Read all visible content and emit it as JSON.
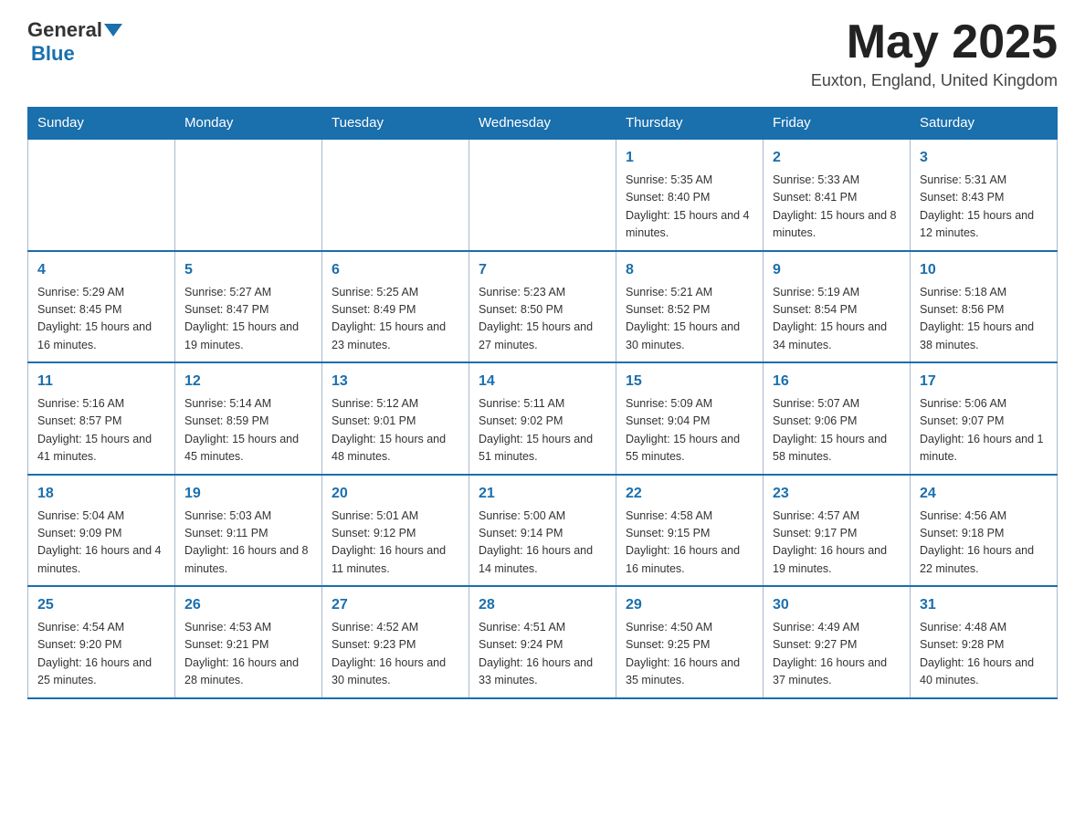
{
  "header": {
    "logo": {
      "general": "General",
      "triangle_label": "triangle-icon",
      "blue": "Blue"
    },
    "title": "May 2025",
    "location": "Euxton, England, United Kingdom"
  },
  "days_of_week": [
    "Sunday",
    "Monday",
    "Tuesday",
    "Wednesday",
    "Thursday",
    "Friday",
    "Saturday"
  ],
  "weeks": [
    [
      {
        "day": "",
        "info": ""
      },
      {
        "day": "",
        "info": ""
      },
      {
        "day": "",
        "info": ""
      },
      {
        "day": "",
        "info": ""
      },
      {
        "day": "1",
        "info": "Sunrise: 5:35 AM\nSunset: 8:40 PM\nDaylight: 15 hours\nand 4 minutes."
      },
      {
        "day": "2",
        "info": "Sunrise: 5:33 AM\nSunset: 8:41 PM\nDaylight: 15 hours\nand 8 minutes."
      },
      {
        "day": "3",
        "info": "Sunrise: 5:31 AM\nSunset: 8:43 PM\nDaylight: 15 hours\nand 12 minutes."
      }
    ],
    [
      {
        "day": "4",
        "info": "Sunrise: 5:29 AM\nSunset: 8:45 PM\nDaylight: 15 hours\nand 16 minutes."
      },
      {
        "day": "5",
        "info": "Sunrise: 5:27 AM\nSunset: 8:47 PM\nDaylight: 15 hours\nand 19 minutes."
      },
      {
        "day": "6",
        "info": "Sunrise: 5:25 AM\nSunset: 8:49 PM\nDaylight: 15 hours\nand 23 minutes."
      },
      {
        "day": "7",
        "info": "Sunrise: 5:23 AM\nSunset: 8:50 PM\nDaylight: 15 hours\nand 27 minutes."
      },
      {
        "day": "8",
        "info": "Sunrise: 5:21 AM\nSunset: 8:52 PM\nDaylight: 15 hours\nand 30 minutes."
      },
      {
        "day": "9",
        "info": "Sunrise: 5:19 AM\nSunset: 8:54 PM\nDaylight: 15 hours\nand 34 minutes."
      },
      {
        "day": "10",
        "info": "Sunrise: 5:18 AM\nSunset: 8:56 PM\nDaylight: 15 hours\nand 38 minutes."
      }
    ],
    [
      {
        "day": "11",
        "info": "Sunrise: 5:16 AM\nSunset: 8:57 PM\nDaylight: 15 hours\nand 41 minutes."
      },
      {
        "day": "12",
        "info": "Sunrise: 5:14 AM\nSunset: 8:59 PM\nDaylight: 15 hours\nand 45 minutes."
      },
      {
        "day": "13",
        "info": "Sunrise: 5:12 AM\nSunset: 9:01 PM\nDaylight: 15 hours\nand 48 minutes."
      },
      {
        "day": "14",
        "info": "Sunrise: 5:11 AM\nSunset: 9:02 PM\nDaylight: 15 hours\nand 51 minutes."
      },
      {
        "day": "15",
        "info": "Sunrise: 5:09 AM\nSunset: 9:04 PM\nDaylight: 15 hours\nand 55 minutes."
      },
      {
        "day": "16",
        "info": "Sunrise: 5:07 AM\nSunset: 9:06 PM\nDaylight: 15 hours\nand 58 minutes."
      },
      {
        "day": "17",
        "info": "Sunrise: 5:06 AM\nSunset: 9:07 PM\nDaylight: 16 hours\nand 1 minute."
      }
    ],
    [
      {
        "day": "18",
        "info": "Sunrise: 5:04 AM\nSunset: 9:09 PM\nDaylight: 16 hours\nand 4 minutes."
      },
      {
        "day": "19",
        "info": "Sunrise: 5:03 AM\nSunset: 9:11 PM\nDaylight: 16 hours\nand 8 minutes."
      },
      {
        "day": "20",
        "info": "Sunrise: 5:01 AM\nSunset: 9:12 PM\nDaylight: 16 hours\nand 11 minutes."
      },
      {
        "day": "21",
        "info": "Sunrise: 5:00 AM\nSunset: 9:14 PM\nDaylight: 16 hours\nand 14 minutes."
      },
      {
        "day": "22",
        "info": "Sunrise: 4:58 AM\nSunset: 9:15 PM\nDaylight: 16 hours\nand 16 minutes."
      },
      {
        "day": "23",
        "info": "Sunrise: 4:57 AM\nSunset: 9:17 PM\nDaylight: 16 hours\nand 19 minutes."
      },
      {
        "day": "24",
        "info": "Sunrise: 4:56 AM\nSunset: 9:18 PM\nDaylight: 16 hours\nand 22 minutes."
      }
    ],
    [
      {
        "day": "25",
        "info": "Sunrise: 4:54 AM\nSunset: 9:20 PM\nDaylight: 16 hours\nand 25 minutes."
      },
      {
        "day": "26",
        "info": "Sunrise: 4:53 AM\nSunset: 9:21 PM\nDaylight: 16 hours\nand 28 minutes."
      },
      {
        "day": "27",
        "info": "Sunrise: 4:52 AM\nSunset: 9:23 PM\nDaylight: 16 hours\nand 30 minutes."
      },
      {
        "day": "28",
        "info": "Sunrise: 4:51 AM\nSunset: 9:24 PM\nDaylight: 16 hours\nand 33 minutes."
      },
      {
        "day": "29",
        "info": "Sunrise: 4:50 AM\nSunset: 9:25 PM\nDaylight: 16 hours\nand 35 minutes."
      },
      {
        "day": "30",
        "info": "Sunrise: 4:49 AM\nSunset: 9:27 PM\nDaylight: 16 hours\nand 37 minutes."
      },
      {
        "day": "31",
        "info": "Sunrise: 4:48 AM\nSunset: 9:28 PM\nDaylight: 16 hours\nand 40 minutes."
      }
    ]
  ]
}
